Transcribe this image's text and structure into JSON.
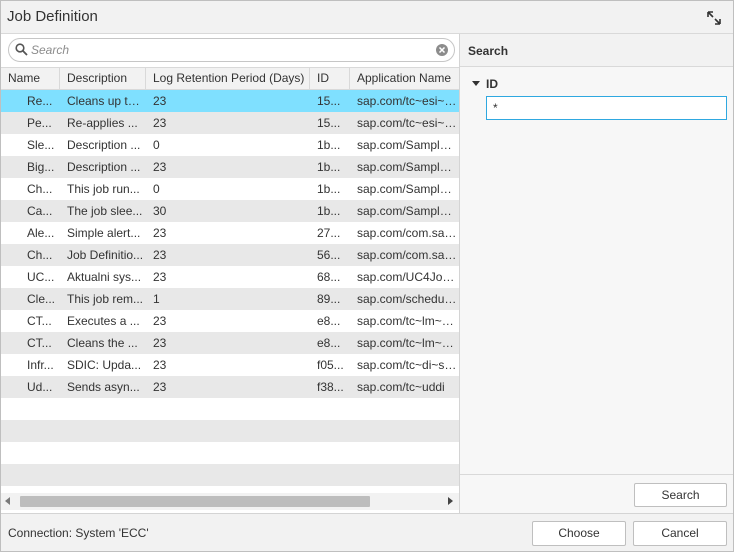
{
  "window": {
    "title": "Job Definition",
    "expand_icon": "expand-icon"
  },
  "search": {
    "placeholder": "Search",
    "value": ""
  },
  "table": {
    "columns": [
      "Name",
      "Description",
      "Log Retention Period (Days)",
      "ID",
      "Application Name"
    ],
    "rows": [
      [
        "Re...",
        "Cleans up th...",
        "23",
        "15...",
        "sap.com/tc~esi~ud..."
      ],
      [
        "Pe...",
        "Re-applies ...",
        "23",
        "15...",
        "sap.com/tc~esi~ud..."
      ],
      [
        "Sle...",
        "Description ...",
        "0",
        "1b...",
        "sap.com/SampleJo..."
      ],
      [
        "Big...",
        "Description ...",
        "23",
        "1b...",
        "sap.com/SampleJo..."
      ],
      [
        "Ch...",
        "This job run...",
        "0",
        "1b...",
        "sap.com/SampleJo..."
      ],
      [
        "Ca...",
        "The job slee...",
        "30",
        "1b...",
        "sap.com/SampleJo..."
      ],
      [
        "Ale...",
        "Simple alert...",
        "23",
        "27...",
        "sap.com/com.sap...."
      ],
      [
        "Ch...",
        "Job Definitio...",
        "23",
        "56...",
        "sap.com/com.sap.lc..."
      ],
      [
        "UC...",
        "Aktualni sys...",
        "23",
        "68...",
        "sap.com/UC4JobP..."
      ],
      [
        "Cle...",
        "This job rem...",
        "1",
        "89...",
        "sap.com/schedule..."
      ],
      [
        "CT...",
        "Executes a ...",
        "23",
        "e8...",
        "sap.com/tc~lm~ctc..."
      ],
      [
        "CT...",
        "Cleans the ...",
        "23",
        "e8...",
        "sap.com/tc~lm~ctc..."
      ],
      [
        "Infr...",
        "SDIC: Upda...",
        "23",
        "f05...",
        "sap.com/tc~di~sdi..."
      ],
      [
        "Ud...",
        "Sends asyn...",
        "23",
        "f38...",
        "sap.com/tc~uddi"
      ]
    ],
    "selected_row": 0,
    "empty_rows": 4
  },
  "right_panel": {
    "title": "Search",
    "section_label": "ID",
    "id_value": "*",
    "search_button": "Search"
  },
  "footer": {
    "status": "Connection: System 'ECC'",
    "choose_button": "Choose",
    "cancel_button": "Cancel"
  },
  "colors": {
    "selected_row": "#7fe0ff",
    "alt_row": "#e8e8e8",
    "focus_border": "#2fa8e0"
  }
}
